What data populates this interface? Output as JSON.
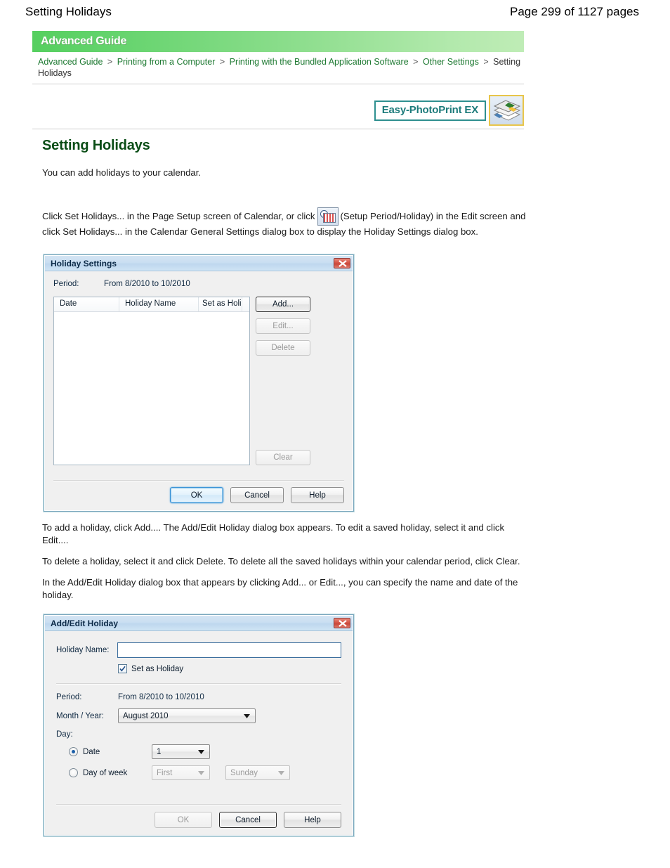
{
  "page": {
    "doc_title": "Setting Holidays",
    "page_indicator": "Page 299 of 1127 pages"
  },
  "guide": {
    "banner_label": "Advanced Guide",
    "breadcrumb": [
      {
        "label": "Advanced Guide",
        "link": true
      },
      {
        "label": "Printing from a Computer",
        "link": true
      },
      {
        "label": "Printing with the Bundled Application Software",
        "link": true
      },
      {
        "label": "Other Settings",
        "link": true
      },
      {
        "label": "Setting Holidays",
        "link": false
      }
    ],
    "separator": ">"
  },
  "product": {
    "logo_text": "Easy-PhotoPrint EX",
    "logo_icon": "photo-stack-icon"
  },
  "main": {
    "section_title": "Setting Holidays",
    "paragraph_1": "You can add holidays to your calendar.",
    "paragraph_2_part1": "Click Set Holidays... in the Page Setup screen of Calendar, or click",
    "paragraph_2_icon": "setup-period-holiday-icon",
    "paragraph_2_part2": "(Setup Period/Holiday) in the Edit screen and click Set Holidays... in the Calendar General Settings dialog box to display the Holiday Settings dialog box.",
    "paragraph_3": "To add a holiday, click Add.... The Add/Edit Holiday dialog box appears. To edit a saved holiday, select it and click Edit....",
    "paragraph_4": "To delete a holiday, select it and click Delete. To delete all the saved holidays within your calendar period, click Clear.",
    "paragraph_5": "In the Add/Edit Holiday dialog box that appears by clicking Add... or Edit..., you can specify the name and date of the holiday."
  },
  "holiday_settings_dialog": {
    "title": "Holiday Settings",
    "close_icon": "close-icon",
    "period_label": "Period:",
    "period_value": "From 8/2010 to 10/2010",
    "columns": [
      "Date",
      "Holiday Name",
      "Set as Holiday"
    ],
    "rows": [],
    "buttons": {
      "add": "Add...",
      "edit": "Edit...",
      "delete": "Delete",
      "clear": "Clear",
      "ok": "OK",
      "cancel": "Cancel",
      "help": "Help"
    }
  },
  "add_edit_holiday_dialog": {
    "title": "Add/Edit Holiday",
    "close_icon": "close-icon",
    "holiday_name_label": "Holiday Name:",
    "holiday_name_value": "",
    "set_as_holiday_label": "Set as Holiday",
    "set_as_holiday_checked": true,
    "period_label": "Period:",
    "period_value": "From 8/2010 to 10/2010",
    "month_year_label": "Month / Year:",
    "month_year_value": "August 2010",
    "day_label": "Day:",
    "date_radio_label": "Date",
    "date_value": "1",
    "day_of_week_radio_label": "Day of week",
    "week_ordinal_value": "First",
    "weekday_value": "Sunday",
    "day_mode_selected": "date",
    "buttons": {
      "ok": "OK",
      "cancel": "Cancel",
      "help": "Help"
    }
  },
  "colors": {
    "banner_green": "#66d46e",
    "link_green": "#1f7a33",
    "heading_green": "#0a4d16",
    "logo_teal": "#2e8f8f",
    "dialog_border": "#7aa7bd",
    "close_red": "#d8584a"
  }
}
